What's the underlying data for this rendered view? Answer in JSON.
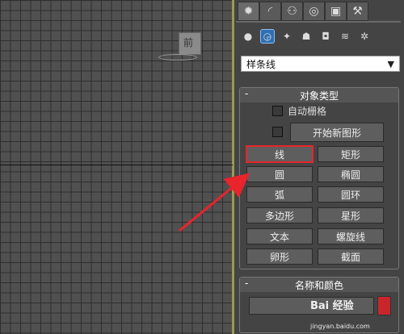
{
  "viewport": {
    "camera_label": "前"
  },
  "command_panel": {
    "tabs": [
      {
        "icon": "create-icon",
        "glyph": "✹"
      },
      {
        "icon": "modify-icon",
        "glyph": "◜"
      },
      {
        "icon": "hierarchy-icon",
        "glyph": "⚇"
      },
      {
        "icon": "motion-icon",
        "glyph": "◎"
      },
      {
        "icon": "display-icon",
        "glyph": "▣"
      },
      {
        "icon": "utilities-icon",
        "glyph": "⚒"
      }
    ],
    "categories": [
      {
        "icon": "geometry-icon",
        "glyph": "●"
      },
      {
        "icon": "shapes-icon",
        "glyph": "◶"
      },
      {
        "icon": "lights-icon",
        "glyph": "✦"
      },
      {
        "icon": "cameras-icon",
        "glyph": "☗"
      },
      {
        "icon": "helpers-icon",
        "glyph": "◘"
      },
      {
        "icon": "spacewarps-icon",
        "glyph": "≋"
      },
      {
        "icon": "systems-icon",
        "glyph": "✲"
      }
    ],
    "dropdown_value": "样条线",
    "object_type": {
      "title": "对象类型",
      "collapse_glyph": "-",
      "auto_grid_label": "自动栅格",
      "start_new_shape_label": "开始新图形",
      "buttons": [
        [
          "线",
          "矩形"
        ],
        [
          "圆",
          "椭圆"
        ],
        [
          "弧",
          "圆环"
        ],
        [
          "多边形",
          "星形"
        ],
        [
          "文本",
          "螺旋线"
        ],
        [
          "卵形",
          "截面"
        ]
      ]
    },
    "name_and_color": {
      "title": "名称和颜色",
      "collapse_glyph": "-",
      "name_value": "",
      "color": "#c8262c"
    }
  },
  "annotation": {
    "highlight_color": "#e8242c"
  },
  "watermark": {
    "brand": "Bai 经验",
    "url": "jingyan.baidu.com"
  }
}
